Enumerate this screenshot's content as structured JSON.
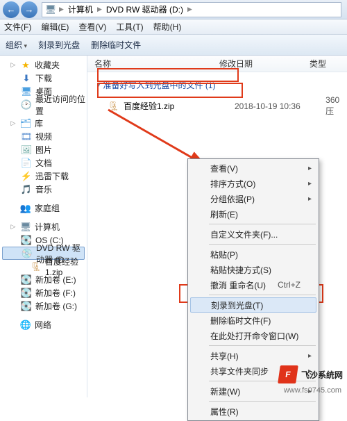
{
  "titlebar": {
    "back_icon": "←",
    "fwd_icon": "→",
    "crumb1": "计算机",
    "crumb2": "DVD RW 驱动器 (D:)"
  },
  "menu": {
    "file": "文件(F)",
    "edit": "编辑(E)",
    "view": "查看(V)",
    "tools": "工具(T)",
    "help": "帮助(H)"
  },
  "toolbar": {
    "organize": "组织",
    "burn": "刻录到光盘",
    "delete_temp": "删除临时文件"
  },
  "columns": {
    "name": "名称",
    "date": "修改日期",
    "type": "类型"
  },
  "sidebar": {
    "favorites": "收藏夹",
    "downloads": "下载",
    "desktop": "桌面",
    "recent": "最近访问的位置",
    "libraries": "库",
    "videos": "视频",
    "pictures": "图片",
    "documents": "文档",
    "thunder_dl": "迅雷下载",
    "music": "音乐",
    "homegroup": "家庭组",
    "computer": "计算机",
    "osc": "OS (C:)",
    "dvd": "DVD RW 驱动器 (D",
    "zipfile": "百度经验1.zip",
    "vol_e": "新加卷 (E:)",
    "vol_f": "新加卷 (F:)",
    "vol_g": "新加卷 (G:)",
    "network": "网络"
  },
  "group_header": "准备好写入到光盘中的文件 (1)",
  "file": {
    "name": "百度经验1.zip",
    "date": "2018-10-19 10:36",
    "type": "360压"
  },
  "context_menu": {
    "view": "查看(V)",
    "sort": "排序方式(O)",
    "group": "分组依据(P)",
    "refresh": "刷新(E)",
    "customize": "自定义文件夹(F)...",
    "paste": "粘贴(P)",
    "paste_shortcut": "粘贴快捷方式(S)",
    "undo_rename": "撤消 重命名(U)",
    "undo_shortcut": "Ctrl+Z",
    "burn": "刻录到光盘(T)",
    "delete_temp": "删除临时文件(F)",
    "open_cmd": "在此处打开命令窗口(W)",
    "share": "共享(H)",
    "sync": "共享文件夹同步",
    "new": "新建(W)",
    "properties": "属性(R)"
  },
  "watermark": "www.fs0745.com",
  "badge": "飞沙系统网"
}
